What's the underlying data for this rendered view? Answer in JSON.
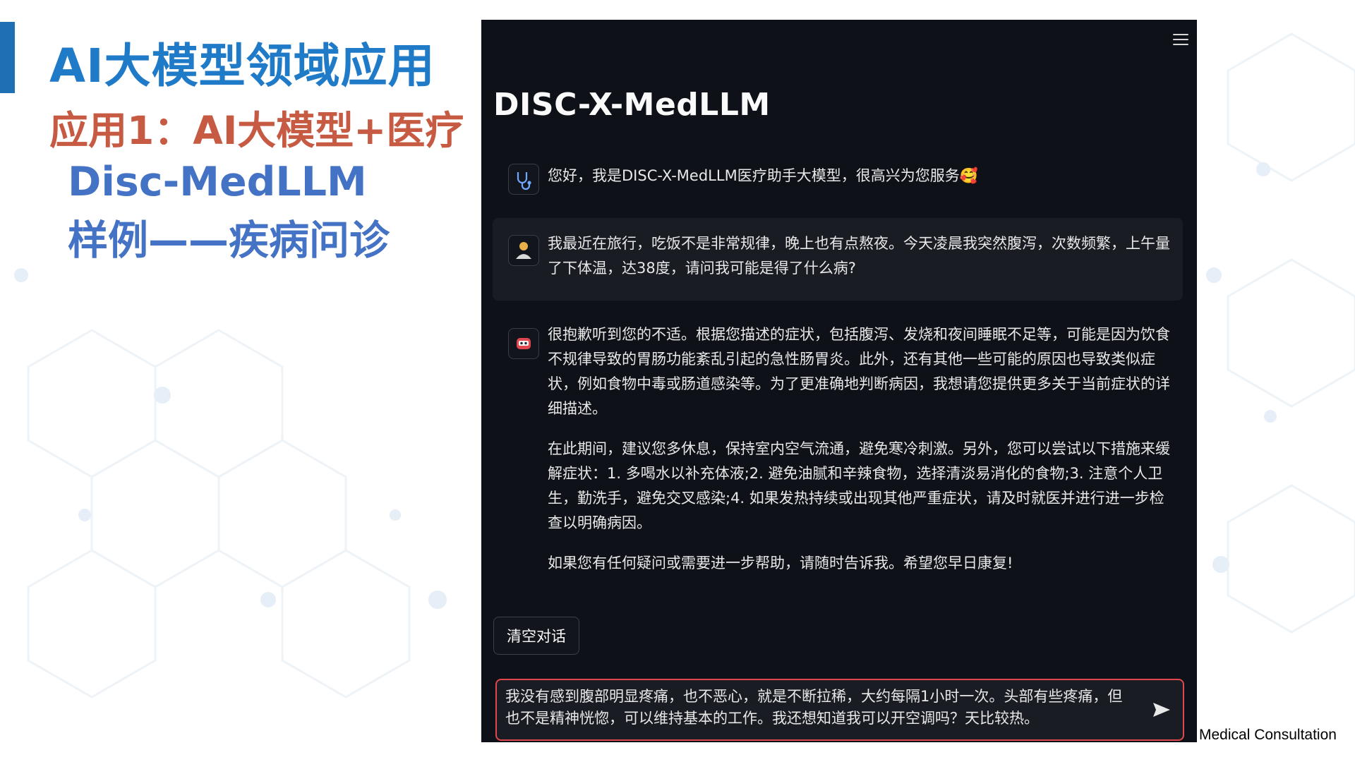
{
  "slide": {
    "title": "AI大模型领域应用",
    "subtitle": "应用1：AI大模型+医疗",
    "model_name": "Disc-MedLLM",
    "example_label": "样例——疾病问诊",
    "caption": "Medical Consultation",
    "colors": {
      "title": "#1f7ac7",
      "subtitle": "#c65a42",
      "model": "#4472c4",
      "accent_bar": "#1f6fb5"
    }
  },
  "app": {
    "title": "DISC-X-MedLLM",
    "menu_icon": "hamburger-menu-icon",
    "colors": {
      "background": "#0e1117",
      "user_bubble": "#1a1c24",
      "input_border": "#e0474f"
    },
    "messages": [
      {
        "role": "assistant",
        "icon": "stethoscope-icon",
        "paragraphs": [
          "您好，我是DISC-X-MedLLM医疗助手大模型，很高兴为您服务🥰"
        ]
      },
      {
        "role": "user",
        "icon": "user-avatar-icon",
        "paragraphs": [
          "我最近在旅行，吃饭不是非常规律，晚上也有点熬夜。今天凌晨我突然腹泻，次数频繁，上午量了下体温，达38度，请问我可能是得了什么病?"
        ]
      },
      {
        "role": "assistant",
        "icon": "robot-icon",
        "paragraphs": [
          "很抱歉听到您的不适。根据您描述的症状，包括腹泻、发烧和夜间睡眠不足等，可能是因为饮食不规律导致的胃肠功能紊乱引起的急性肠胃炎。此外，还有其他一些可能的原因也导致类似症状，例如食物中毒或肠道感染等。为了更准确地判断病因，我想请您提供更多关于当前症状的详细描述。",
          "在此期间，建议您多休息，保持室内空气流通，避免寒冷刺激。另外，您可以尝试以下措施来缓解症状：1. 多喝水以补充体液;2. 避免油腻和辛辣食物，选择清淡易消化的食物;3. 注意个人卫生，勤洗手，避免交叉感染;4. 如果发热持续或出现其他严重症状，请及时就医并进行进一步检查以明确病因。",
          "如果您有任何疑问或需要进一步帮助，请随时告诉我。希望您早日康复!"
        ]
      }
    ],
    "clear_button": "清空对话",
    "input_value": "我没有感到腹部明显疼痛，也不恶心，就是不断拉稀，大约每隔1小时一次。头部有些疼痛，但也不是精神恍惚，可以维持基本的工作。我还想知道我可以开空调吗？天比较热。",
    "send_icon": "send-arrow-icon"
  }
}
